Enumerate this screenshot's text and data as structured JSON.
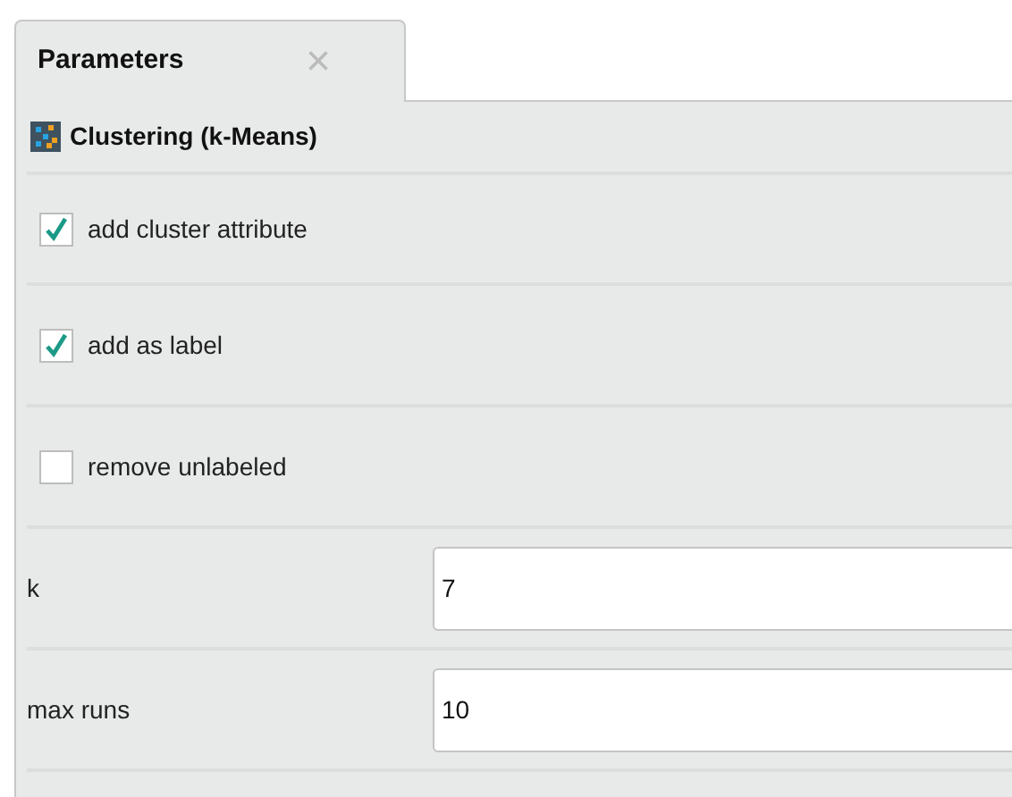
{
  "tab": {
    "label": "Parameters",
    "close": "×",
    "selected": true
  },
  "operator": {
    "title": "Clustering (k-Means)"
  },
  "parameters": [
    {
      "kind": "checkbox",
      "label": "add cluster attribute",
      "checked": true
    },
    {
      "kind": "checkbox",
      "label": "add as label",
      "checked": true
    },
    {
      "kind": "checkbox",
      "label": "remove unlabeled",
      "checked": false
    },
    {
      "kind": "field",
      "label": "k",
      "value": "7"
    },
    {
      "kind": "field",
      "label": "max runs",
      "value": "10"
    }
  ]
}
